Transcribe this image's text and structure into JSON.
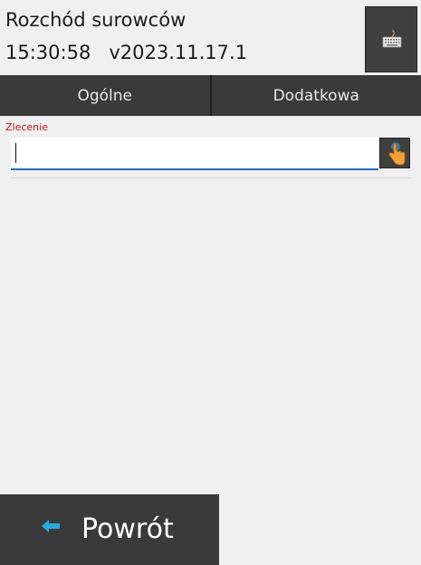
{
  "header": {
    "title": "Rozchód surowców",
    "time": "15:30:58",
    "version": "v2023.11.17.1",
    "keyboard_icon": "keyboard-icon"
  },
  "tabs": [
    {
      "label": "Ogólne"
    },
    {
      "label": "Dodatkowa"
    }
  ],
  "form": {
    "order_label": "Zlecenie",
    "order_value": "",
    "touch_icon": "hand-pointer-icon"
  },
  "footer": {
    "back_label": "Powrót",
    "back_icon": "arrow-left-icon"
  },
  "colors": {
    "dark_button": "#3a3a3a",
    "label_red": "#c0141a",
    "input_underline": "#2a6bb8",
    "arrow_blue": "#29a8e0",
    "background": "#f0f0f0"
  }
}
